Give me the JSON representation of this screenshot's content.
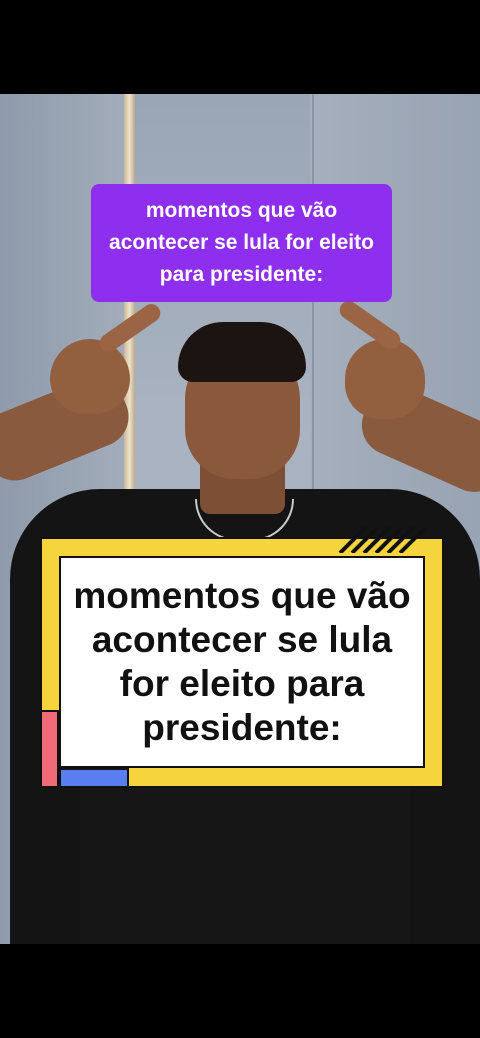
{
  "caption_top": {
    "text": "momentos que vão acontecer se lula for eleito para presidente:",
    "background": "#8e2ff0",
    "color": "#ffffff"
  },
  "card": {
    "text": "momentos que vão acontecer se lula for eleito para presidente:",
    "background": "#f5d43d",
    "inner_background": "#ffffff",
    "accent_red": "#f06a78",
    "accent_blue": "#5b7df2"
  }
}
